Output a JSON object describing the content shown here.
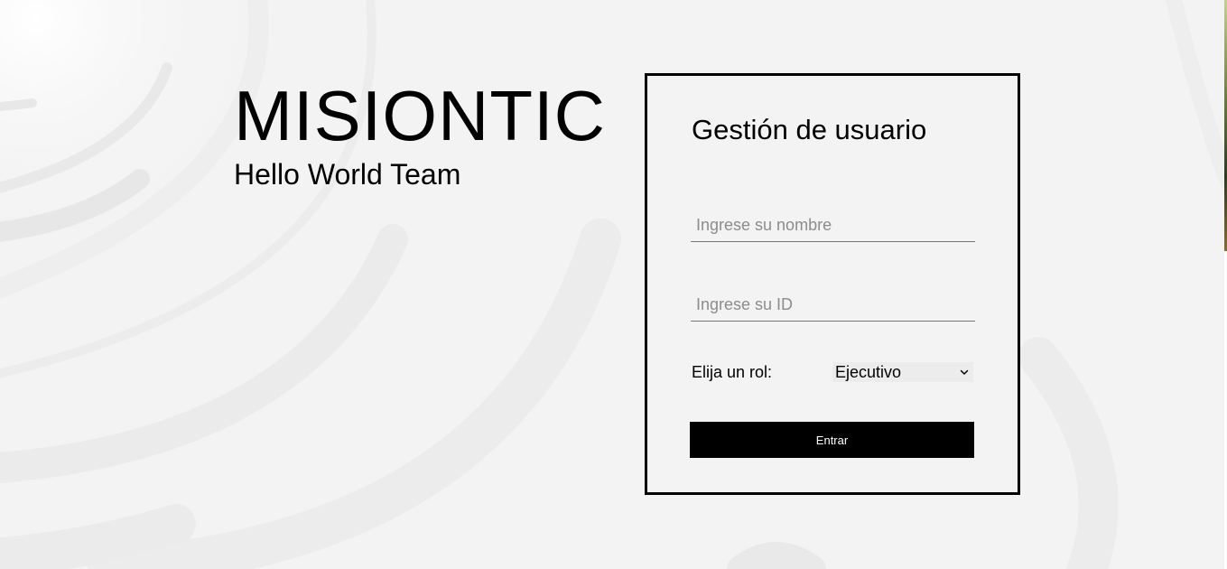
{
  "brand": {
    "title": "MISIONTIC",
    "subtitle": "Hello World Team"
  },
  "form": {
    "title": "Gestión de usuario",
    "name_placeholder": "Ingrese su nombre",
    "id_placeholder": "Ingrese su ID",
    "role_label": "Elija un rol:",
    "role_selected": "Ejecutivo",
    "submit_label": "Entrar"
  },
  "icons": {
    "select_arrow": "chevron-down-icon"
  },
  "colors": {
    "background": "#f3f3f3",
    "card_border": "#000000",
    "button_bg": "#000000",
    "button_text": "#ffffff",
    "placeholder": "#8c8c8c",
    "decor_arc": "#e9e9e9"
  }
}
